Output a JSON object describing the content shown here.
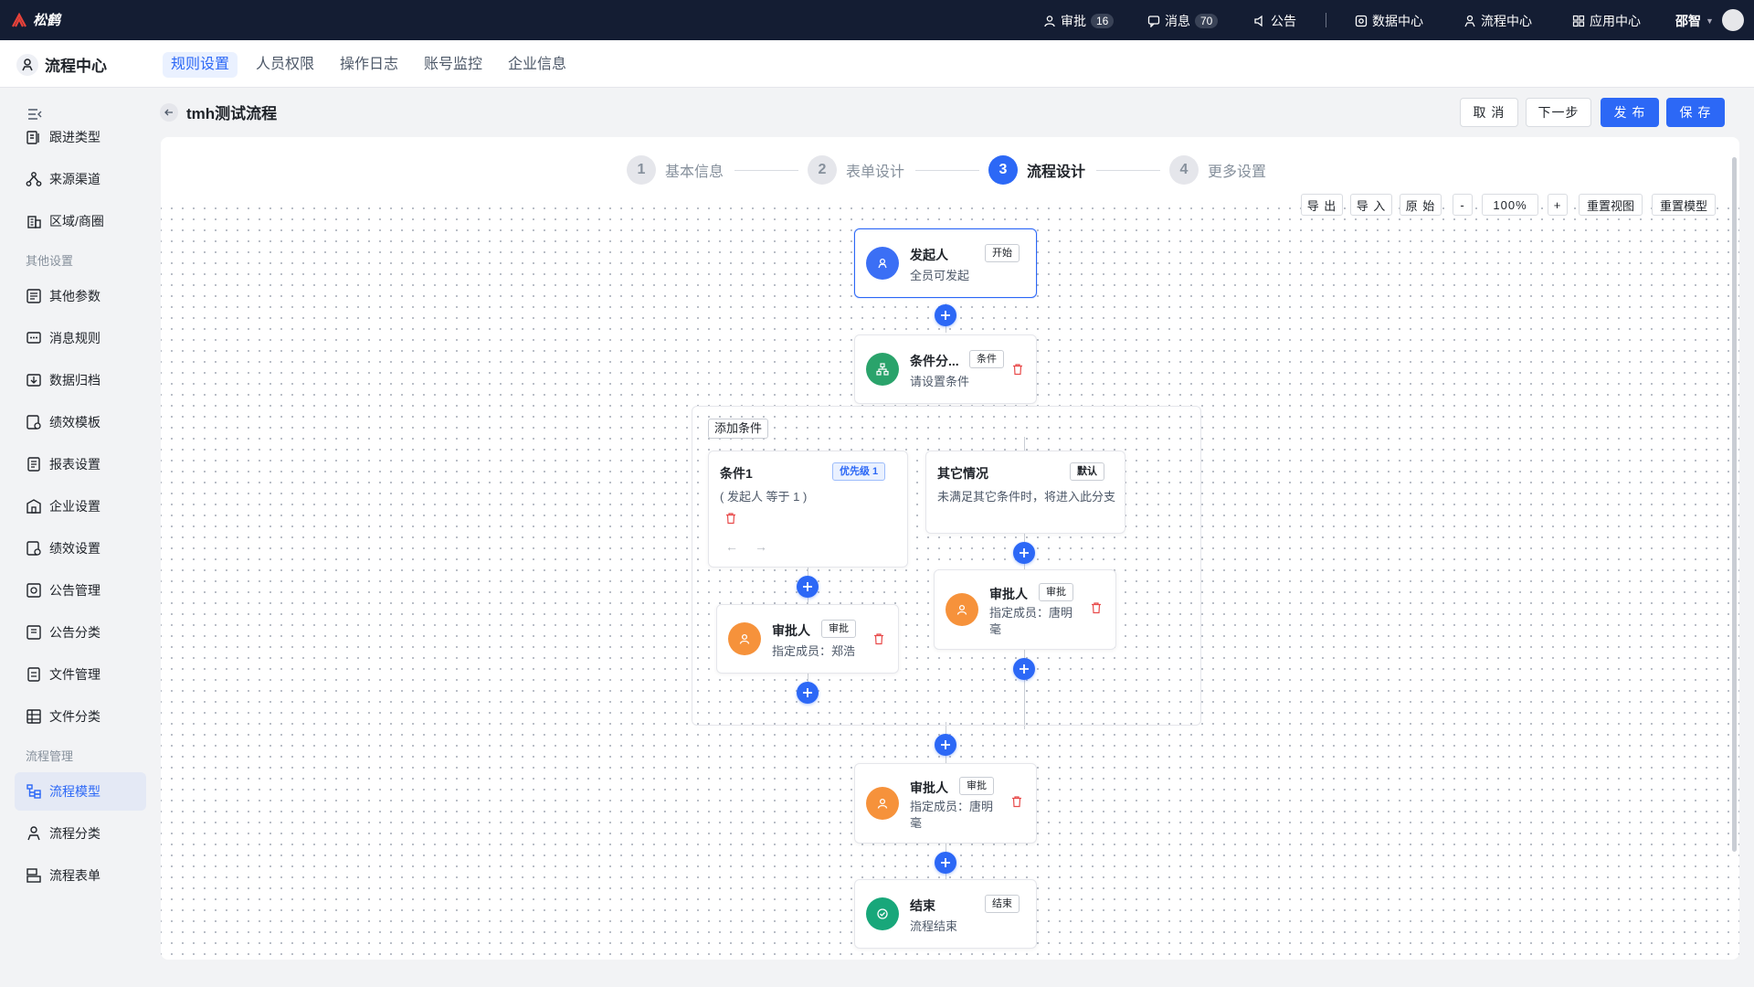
{
  "topbar": {
    "brand": "松鹤",
    "items": [
      {
        "label": "审批",
        "badge": "16"
      },
      {
        "label": "消息",
        "badge": "70"
      },
      {
        "label": "公告"
      },
      {
        "label": "数据中心"
      },
      {
        "label": "流程中心"
      },
      {
        "label": "应用中心"
      }
    ],
    "user": "邵智"
  },
  "subnav": {
    "app_name": "流程中心",
    "tabs": [
      "规则设置",
      "人员权限",
      "操作日志",
      "账号监控",
      "企业信息"
    ],
    "active_tab": "规则设置"
  },
  "sidebar": {
    "items_top": [
      "跟进类型",
      "来源渠道",
      "区域/商圈"
    ],
    "group_other": "其他设置",
    "items_other": [
      "其他参数",
      "消息规则",
      "数据归档",
      "绩效模板",
      "报表设置",
      "企业设置",
      "绩效设置",
      "公告管理",
      "公告分类",
      "文件管理",
      "文件分类"
    ],
    "group_flow": "流程管理",
    "items_flow": [
      "流程模型",
      "流程分类",
      "流程表单"
    ],
    "active": "流程模型"
  },
  "page": {
    "title": "tmh测试流程",
    "actions": {
      "cancel": "取 消",
      "next": "下一步",
      "publish": "发 布",
      "save": "保 存"
    }
  },
  "steps": [
    {
      "num": "1",
      "label": "基本信息"
    },
    {
      "num": "2",
      "label": "表单设计"
    },
    {
      "num": "3",
      "label": "流程设计"
    },
    {
      "num": "4",
      "label": "更多设置"
    }
  ],
  "active_step": 3,
  "toolbar": {
    "export": "导 出",
    "import": "导 入",
    "original": "原 始",
    "zoom_out": "-",
    "zoom": "100%",
    "zoom_in": "+",
    "reset_view": "重置视图",
    "reset_model": "重置模型"
  },
  "flow": {
    "start": {
      "title": "发起人",
      "tag": "开始",
      "desc": "全员可发起"
    },
    "condition_branch": {
      "title": "条件分...",
      "tag": "条件",
      "desc": "请设置条件"
    },
    "add_condition": "添加条件",
    "cond1": {
      "title": "条件1",
      "tag": "优先级 1",
      "desc": "( 发起人 等于 1 )"
    },
    "cond_other": {
      "title": "其它情况",
      "tag": "默认",
      "desc": "未满足其它条件时，将进入此分支"
    },
    "approver_left": {
      "title": "审批人",
      "tag": "审批",
      "desc": "指定成员：郑浩"
    },
    "approver_right": {
      "title": "审批人",
      "tag": "审批",
      "desc": "指定成员：唐明毫"
    },
    "approver_main": {
      "title": "审批人",
      "tag": "审批",
      "desc": "指定成员：唐明毫"
    },
    "end": {
      "title": "结束",
      "tag": "结束",
      "desc": "流程结束"
    }
  },
  "colors": {
    "accent": "#2c68f6",
    "start": "#3b6ff5",
    "condition": "#2aa36b",
    "approver": "#f6923b",
    "end": "#18a77a",
    "topbar": "#141d33"
  }
}
